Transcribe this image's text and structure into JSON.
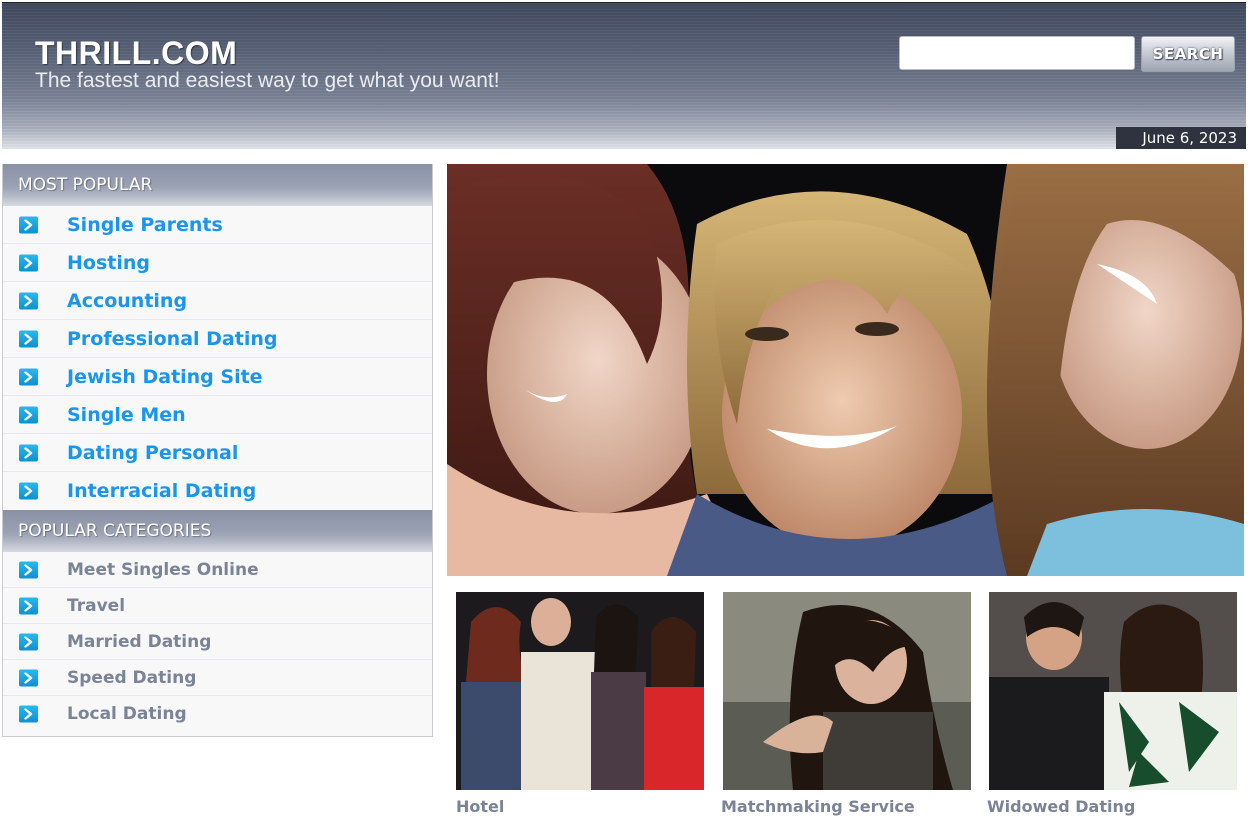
{
  "header": {
    "site_title": "THRILL.COM",
    "tagline": "The fastest and easiest way to get what you want!",
    "search_placeholder": "",
    "search_value": "",
    "search_button": "SEARCH",
    "date": "June 6, 2023"
  },
  "sidebar": {
    "popular": {
      "heading": "MOST POPULAR",
      "items": [
        {
          "label": "Single Parents"
        },
        {
          "label": "Hosting"
        },
        {
          "label": "Accounting"
        },
        {
          "label": "Professional Dating"
        },
        {
          "label": "Jewish Dating Site"
        },
        {
          "label": "Single Men"
        },
        {
          "label": "Dating Personal"
        },
        {
          "label": "Interracial Dating"
        }
      ]
    },
    "categories": {
      "heading": "POPULAR CATEGORIES",
      "items": [
        {
          "label": "Meet Singles Online"
        },
        {
          "label": "Travel"
        },
        {
          "label": "Married Dating"
        },
        {
          "label": "Speed Dating"
        },
        {
          "label": "Local Dating"
        }
      ]
    },
    "bullet_icon": "chevron-right-icon"
  },
  "main": {
    "thumbnails": [
      {
        "caption": "Hotel"
      },
      {
        "caption": "Matchmaking Service"
      },
      {
        "caption": "Widowed Dating"
      }
    ]
  },
  "colors": {
    "link_blue": "#1a95ee",
    "category_gray": "#7b8396",
    "header_dark": "#41495e",
    "bullet_blue": "#0a92d1"
  }
}
